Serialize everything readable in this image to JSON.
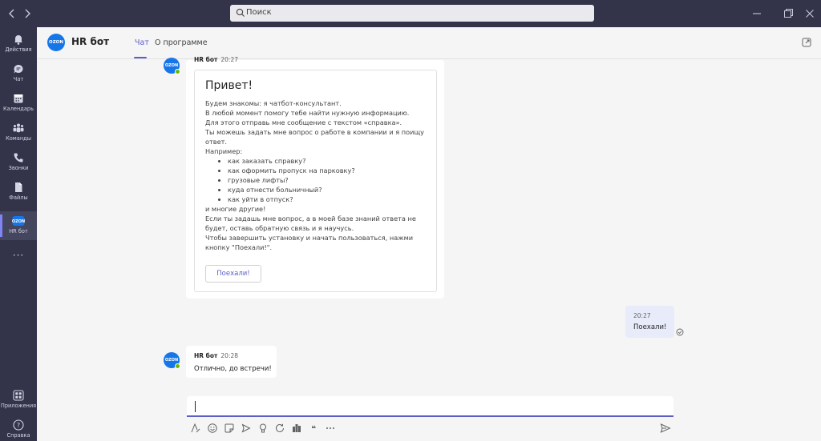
{
  "search": {
    "placeholder": "Поиск"
  },
  "rail": {
    "items": [
      {
        "label": "Действия"
      },
      {
        "label": "Чат"
      },
      {
        "label": "Календарь"
      },
      {
        "label": "Команды"
      },
      {
        "label": "Звонки"
      },
      {
        "label": "Файлы"
      },
      {
        "label": "HR бот"
      }
    ],
    "more": "···",
    "bottom": [
      {
        "label": "Приложения"
      },
      {
        "label": "Справка"
      }
    ]
  },
  "header": {
    "logo_text": "OZON",
    "title": "HR бот",
    "tabs": [
      {
        "label": "Чат"
      },
      {
        "label": "О программе"
      }
    ]
  },
  "messages": {
    "first": {
      "sender": "HR бот",
      "time": "20:27",
      "card": {
        "title": "Привет!",
        "intro": [
          "Будем знакомы: я чатбот-консультант.",
          "В любой момент помогу тебе найти нужную информацию.",
          "Для этого отправь мне сообщение с текстом «справка».",
          "Ты можешь задать мне вопрос о работе в компании и я поищу ответ.",
          "Например:"
        ],
        "examples": [
          "как заказать справку?",
          "как оформить пропуск на парковку?",
          "грузовые лифты?",
          "куда отнести больничный?",
          "как уйти в отпуск?"
        ],
        "outro": [
          "и многие другие!",
          "Если ты задашь мне вопрос, а в моей базе знаний ответа не будет, оставь обратную связь и я научусь.",
          "Чтобы завершить установку и начать пользоваться, нажми кнопку \"Поехали!\"."
        ],
        "button_label": "Поехали!"
      }
    },
    "mine": {
      "time": "20:27",
      "text": "Поехали!"
    },
    "second": {
      "sender": "HR бот",
      "time": "20:28",
      "text": "Отлично, до встречи!"
    }
  },
  "compose": {
    "value": ""
  },
  "toolbar_icons": [
    "format-icon",
    "emoji-icon",
    "sticker-icon",
    "schedule-icon",
    "praise-icon",
    "loop-icon",
    "approvals-icon",
    "quote-icon",
    "more-options-icon",
    "send-icon"
  ]
}
